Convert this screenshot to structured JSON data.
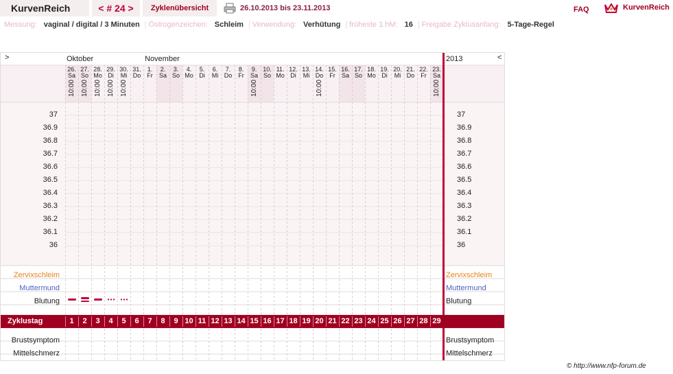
{
  "header": {
    "brand": "KurvenReich",
    "cycle_nav": "< # 24 >",
    "overview_tab": "Zyklenübersicht",
    "date_range": "26.10.2013 bis 23.11.2013",
    "faq": "FAQ",
    "brand_right": "KurvenReich",
    "icons": {
      "print": "printer-icon",
      "logo": "crown-icon"
    }
  },
  "meta": [
    {
      "key": "Messung:",
      "value": "vaginal / digital / 3 Minuten"
    },
    {
      "key": "Östrogenzeichen:",
      "value": "Schleim"
    },
    {
      "key": "Verwendung:",
      "value": "Verhütung"
    },
    {
      "key": "früheste 1.hM:",
      "value": "16"
    },
    {
      "key": "Freigabe Zyklusanfang:",
      "value": "5-Tage-Regel"
    }
  ],
  "chart": {
    "nav_left": ">",
    "nav_right": "<",
    "year": "2013",
    "month_1": "Oktober",
    "month_2": "November",
    "temperature_labels": [
      "37",
      "36.9",
      "36.8",
      "36.7",
      "36.6",
      "36.5",
      "36.4",
      "36.3",
      "36.2",
      "36.1",
      "36"
    ],
    "rows": {
      "zervix": "Zervixschleim",
      "muttermund": "Muttermund",
      "blutung": "Blutung",
      "zyklustag": "Zyklustag",
      "brust": "Brustsymptom",
      "mittel": "Mittelschmerz"
    },
    "days": [
      {
        "d": "26.",
        "w": "Sa",
        "t": "10:00",
        "we": true
      },
      {
        "d": "27.",
        "w": "So",
        "t": "10:00",
        "we": true
      },
      {
        "d": "28.",
        "w": "Mo",
        "t": "10:00",
        "we": false
      },
      {
        "d": "29.",
        "w": "Di",
        "t": "10:00",
        "we": false
      },
      {
        "d": "30.",
        "w": "Mi",
        "t": "10:00",
        "we": false
      },
      {
        "d": "31.",
        "w": "Do",
        "t": "",
        "we": false
      },
      {
        "d": "1.",
        "w": "Fr",
        "t": "",
        "we": false
      },
      {
        "d": "2.",
        "w": "Sa",
        "t": "",
        "we": true
      },
      {
        "d": "3.",
        "w": "So",
        "t": "",
        "we": true
      },
      {
        "d": "4.",
        "w": "Mo",
        "t": "",
        "we": false
      },
      {
        "d": "5.",
        "w": "Di",
        "t": "",
        "we": false
      },
      {
        "d": "6.",
        "w": "Mi",
        "t": "",
        "we": false
      },
      {
        "d": "7.",
        "w": "Do",
        "t": "",
        "we": false
      },
      {
        "d": "8.",
        "w": "Fr",
        "t": "",
        "we": false
      },
      {
        "d": "9.",
        "w": "Sa",
        "t": "10:00",
        "we": true
      },
      {
        "d": "10.",
        "w": "So",
        "t": "",
        "we": true
      },
      {
        "d": "11.",
        "w": "Mo",
        "t": "",
        "we": false
      },
      {
        "d": "12.",
        "w": "Di",
        "t": "",
        "we": false
      },
      {
        "d": "13.",
        "w": "Mi",
        "t": "",
        "we": false
      },
      {
        "d": "14.",
        "w": "Do",
        "t": "10:00",
        "we": false
      },
      {
        "d": "15.",
        "w": "Fr",
        "t": "",
        "we": false
      },
      {
        "d": "16.",
        "w": "Sa",
        "t": "",
        "we": true
      },
      {
        "d": "17.",
        "w": "So",
        "t": "",
        "we": true
      },
      {
        "d": "18.",
        "w": "Mo",
        "t": "",
        "we": false
      },
      {
        "d": "19.",
        "w": "Di",
        "t": "",
        "we": false
      },
      {
        "d": "20.",
        "w": "Mi",
        "t": "",
        "we": false
      },
      {
        "d": "21.",
        "w": "Do",
        "t": "",
        "we": false
      },
      {
        "d": "22.",
        "w": "Fr",
        "t": "",
        "we": false
      },
      {
        "d": "23.",
        "w": "Sa",
        "t": "10:00",
        "we": true
      }
    ],
    "cycle_days": [
      "1",
      "2",
      "3",
      "4",
      "5",
      "6",
      "7",
      "8",
      "9",
      "10",
      "11",
      "12",
      "13",
      "14",
      "15",
      "16",
      "17",
      "18",
      "19",
      "20",
      "21",
      "22",
      "23",
      "24",
      "25",
      "26",
      "27",
      "28",
      "29"
    ],
    "bleeding": [
      {
        "day": 1,
        "level": "normal"
      },
      {
        "day": 2,
        "level": "heavy"
      },
      {
        "day": 3,
        "level": "normal"
      },
      {
        "day": 4,
        "level": "spotting"
      },
      {
        "day": 5,
        "level": "spotting"
      }
    ],
    "colors": {
      "accent": "#a00020",
      "zervix": "#e8821a",
      "muttermund": "#5060c0",
      "weekend": "#f2e4e8"
    }
  },
  "footer": "© http://www.nfp-forum.de"
}
